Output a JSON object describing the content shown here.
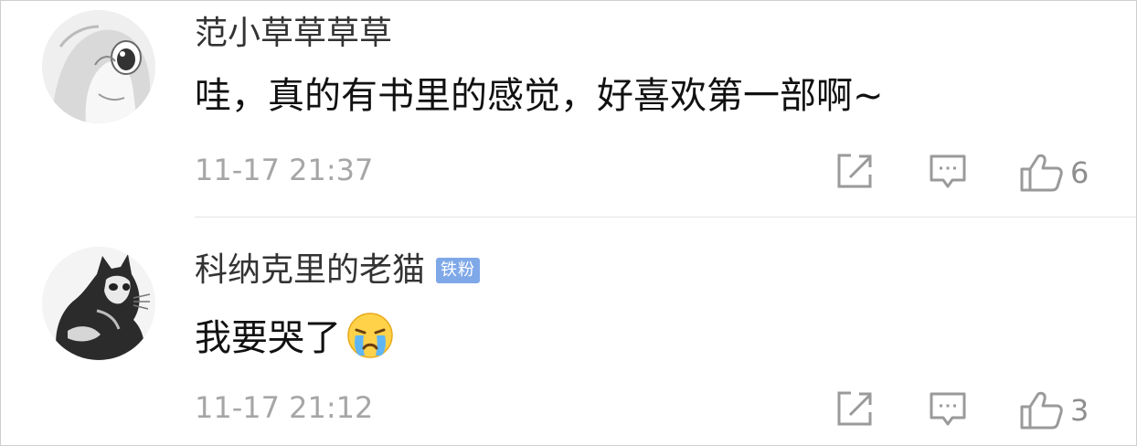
{
  "comments": [
    {
      "username": "范小草草草草",
      "text": "哇，真的有书里的感觉，好喜欢第一部啊~",
      "time": "11-17  21:37",
      "likes": "6",
      "badge": null
    },
    {
      "username": "科纳克里的老猫",
      "text": "我要哭了",
      "time": "11-17  21:12",
      "likes": "3",
      "badge": "铁粉",
      "emoji": "crying-face"
    }
  ],
  "colors": {
    "badge": "#7fa8e8",
    "meta_text": "#a6a6a6",
    "icon_stroke": "#9a9a9a",
    "divider": "#e3e3e3"
  },
  "icons": [
    "share-icon",
    "reply-icon",
    "like-icon"
  ]
}
